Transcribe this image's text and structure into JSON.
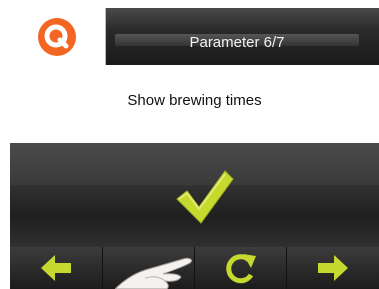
{
  "header": {
    "title": "Parameter 6/7",
    "logo_icon": "q-logo-icon"
  },
  "content": {
    "text": "Show brewing times"
  },
  "confirm": {
    "icon": "checkmark-icon"
  },
  "navbar": {
    "buttons": [
      {
        "name": "back",
        "icon": "arrow-left-icon"
      },
      {
        "name": "blank",
        "icon": ""
      },
      {
        "name": "reset",
        "icon": "refresh-icon"
      },
      {
        "name": "forward",
        "icon": "arrow-right-icon"
      }
    ]
  },
  "colors": {
    "accent_green": "#c6d92e",
    "logo_orange": "#f26522",
    "header_dark": "#2a2a2a"
  }
}
